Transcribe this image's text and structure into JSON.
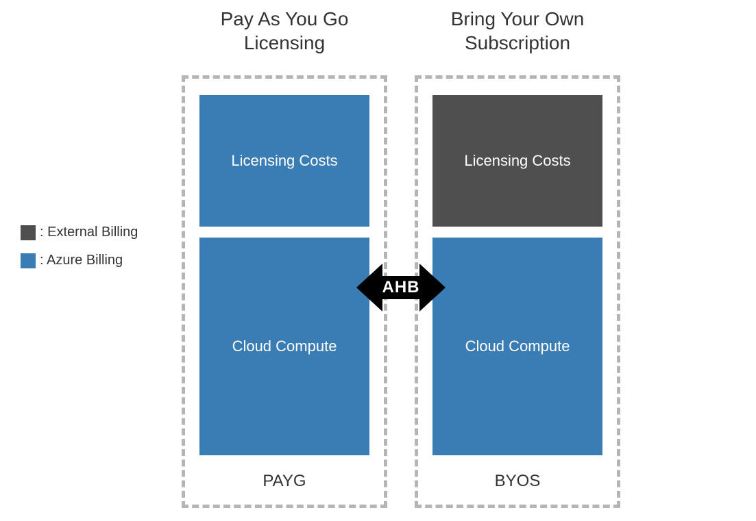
{
  "titles": {
    "left": "Pay As You Go Licensing",
    "right": "Bring Your Own Subscription"
  },
  "legend": {
    "external": ": External Billing",
    "azure": ": Azure Billing"
  },
  "colors": {
    "external": "#4f4f4f",
    "azure": "#3a7cb4"
  },
  "left_box": {
    "licensing": {
      "label": "Licensing Costs",
      "color_key": "azure"
    },
    "compute": {
      "label": "Cloud Compute",
      "color_key": "azure"
    },
    "abbr": "PAYG"
  },
  "right_box": {
    "licensing": {
      "label": "Licensing Costs",
      "color_key": "external"
    },
    "compute": {
      "label": "Cloud Compute",
      "color_key": "azure"
    },
    "abbr": "BYOS"
  },
  "arrow": {
    "label": "AHB"
  }
}
